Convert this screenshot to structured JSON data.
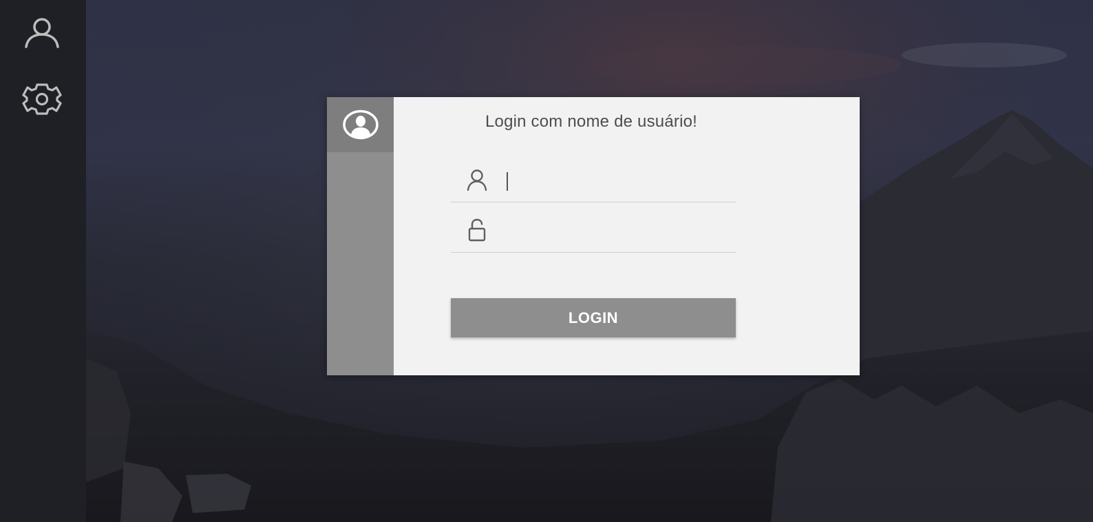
{
  "sidebar": {
    "items": [
      {
        "name": "profile",
        "icon": "user-icon"
      },
      {
        "name": "settings",
        "icon": "gear-icon"
      }
    ]
  },
  "login": {
    "header_icon": "user-circle-icon",
    "title": "Login com nome de usuário!",
    "username": {
      "icon": "user-icon",
      "value": "",
      "placeholder": ""
    },
    "password": {
      "icon": "unlock-icon",
      "value": "",
      "placeholder": ""
    },
    "button_label": "LOGIN"
  },
  "colors": {
    "rail": "#1f2026",
    "card": "#f2f2f2",
    "card_side": "#8e8e8e",
    "button": "#8e8e8e",
    "title_text": "#4d4d4d"
  }
}
